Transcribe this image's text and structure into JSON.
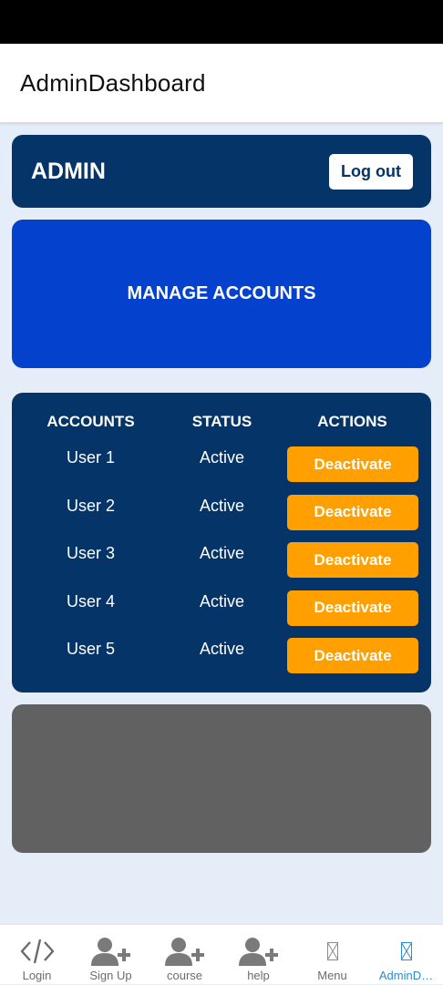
{
  "app_bar": {
    "title": "AdminDashboard"
  },
  "admin_card": {
    "title": "ADMIN",
    "logout_label": "Log out"
  },
  "manage_card": {
    "title": "MANAGE ACCOUNTS"
  },
  "accounts_table": {
    "headers": {
      "accounts": "ACCOUNTS",
      "status": "STATUS",
      "actions": "ACTIONS"
    },
    "rows": [
      {
        "user": "User 1",
        "status": "Active",
        "action": "Deactivate"
      },
      {
        "user": "User 2",
        "status": "Active",
        "action": "Deactivate"
      },
      {
        "user": "User 3",
        "status": "Active",
        "action": "Deactivate"
      },
      {
        "user": "User 4",
        "status": "Active",
        "action": "Deactivate"
      },
      {
        "user": "User 5",
        "status": "Active",
        "action": "Deactivate"
      }
    ]
  },
  "bottom_nav": {
    "items": [
      {
        "label": "Login",
        "icon": "code-icon"
      },
      {
        "label": "Sign Up",
        "icon": "add-user-icon"
      },
      {
        "label": "course",
        "icon": "add-user-icon"
      },
      {
        "label": "help",
        "icon": "add-user-icon"
      },
      {
        "label": "Menu",
        "icon": "missing-glyph-icon"
      },
      {
        "label": "AdminD…",
        "icon": "missing-glyph-icon",
        "active": true
      }
    ]
  },
  "colors": {
    "navy": "#053468",
    "blue": "#0441cc",
    "orange": "#ffa000",
    "grey": "#616161",
    "background": "#e5eef8",
    "active_nav": "#2b8ad0"
  }
}
